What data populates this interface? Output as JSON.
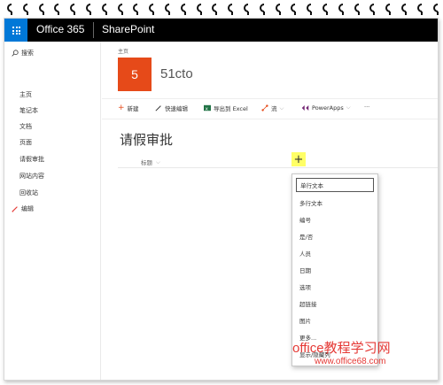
{
  "suitebar": {
    "app_name": "Office 365",
    "site_name": "SharePoint"
  },
  "leftnav": {
    "search_label": "搜索",
    "items": [
      {
        "label": "主页"
      },
      {
        "label": "笔记本"
      },
      {
        "label": "文档"
      },
      {
        "label": "页面"
      },
      {
        "label": "请假审批"
      },
      {
        "label": "网站内容"
      },
      {
        "label": "回收站"
      }
    ],
    "edit_label": "编辑"
  },
  "header": {
    "breadcrumb": "主页",
    "logo_letter": "5",
    "site_title": "51cto"
  },
  "commandbar": {
    "new_label": "新建",
    "quick_edit_label": "快速编辑",
    "export_excel_label": "导出到 Excel",
    "flow_label": "流",
    "powerapps_label": "PowerApps",
    "more_label": "···"
  },
  "list": {
    "title": "请假审批",
    "column_header": "标题",
    "add_column_symbol": "+"
  },
  "add_column_menu": {
    "items": [
      "单行文本",
      "多行文本",
      "编号",
      "是/否",
      "人员",
      "日期",
      "选项",
      "超链接",
      "图片",
      "更多...",
      "显示/隐藏列"
    ]
  },
  "watermark": {
    "line1": "office教程学习网",
    "line2": "www.office68.com"
  },
  "colors": {
    "suitebar": "#000000",
    "waffle": "#0078d7",
    "site_logo": "#e64a19",
    "add_column_highlight": "#ffff66",
    "watermark": "#e53935"
  }
}
